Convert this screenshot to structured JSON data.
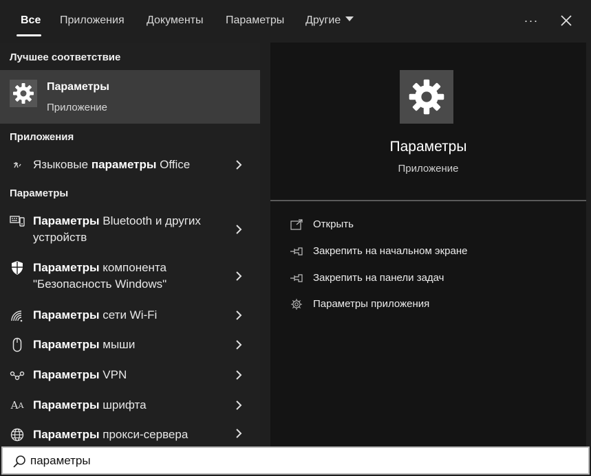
{
  "tabs": [
    {
      "label": "Все",
      "active": true
    },
    {
      "label": "Приложения"
    },
    {
      "label": "Документы"
    },
    {
      "label": "Параметры"
    },
    {
      "label": "Другие"
    }
  ],
  "top_buttons": {
    "more": "···",
    "close_icon": "close-icon"
  },
  "left": {
    "best_match_title": "Лучшее соответствие",
    "best_match": {
      "name": "Параметры",
      "type": "Приложение",
      "icon": "gear-icon"
    },
    "apps_title": "Приложения",
    "apps": [
      {
        "bold": "",
        "pre": "Языковые ",
        "b": "параметры",
        "post": " Office",
        "icon": "language-icon"
      }
    ],
    "settings_title": "Параметры",
    "settings": [
      {
        "b": "Параметры",
        "post": " Bluetooth и других устройств",
        "icon": "devices-icon"
      },
      {
        "b": "Параметры",
        "post": " компонента \"Безопасность Windows\"",
        "icon": "shield-icon"
      },
      {
        "b": "Параметры",
        "post": " сети Wi-Fi",
        "icon": "wifi-icon"
      },
      {
        "b": "Параметры",
        "post": " мыши",
        "icon": "mouse-icon"
      },
      {
        "b": "Параметры",
        "post": " VPN",
        "icon": "vpn-icon"
      },
      {
        "b": "Параметры",
        "post": " шрифта",
        "icon": "font-icon"
      },
      {
        "b": "Параметры",
        "post": " прокси-сервера",
        "icon": "globe-icon"
      }
    ]
  },
  "right": {
    "title": "Параметры",
    "subtitle": "Приложение",
    "actions": [
      {
        "label": "Открыть",
        "icon": "open-icon"
      },
      {
        "label": "Закрепить на начальном экране",
        "icon": "pin-icon"
      },
      {
        "label": "Закрепить на панели задач",
        "icon": "pin-icon"
      },
      {
        "label": "Параметры приложения",
        "icon": "gear-icon"
      }
    ]
  },
  "search": {
    "value": "параметры",
    "icon": "search-icon"
  }
}
